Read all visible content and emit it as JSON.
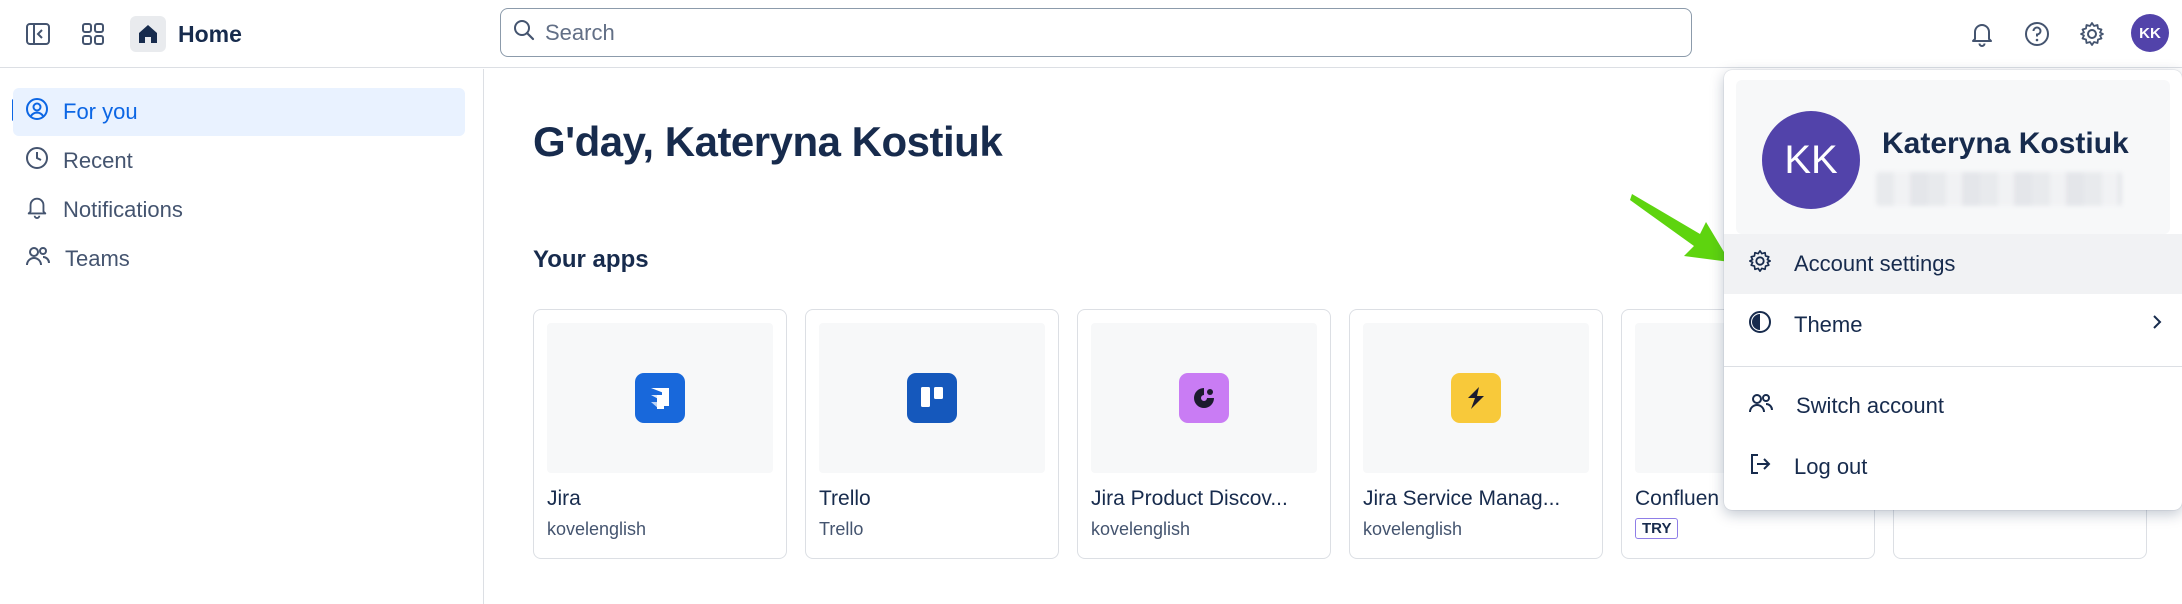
{
  "topbar": {
    "home_label": "Home",
    "search_placeholder": "Search",
    "avatar_initials": "KK"
  },
  "sidebar": {
    "items": [
      {
        "label": "For you",
        "icon": "user-circle-icon",
        "active": true
      },
      {
        "label": "Recent",
        "icon": "clock-icon",
        "active": false
      },
      {
        "label": "Notifications",
        "icon": "bell-icon",
        "active": false
      },
      {
        "label": "Teams",
        "icon": "people-icon",
        "active": false
      }
    ]
  },
  "main": {
    "greeting": "G'day, Kateryna Kostiuk",
    "apps_title": "Your apps",
    "apps": [
      {
        "name": "Jira",
        "sub": "kovelenglish",
        "icon": "jira-icon",
        "color": "#1868db"
      },
      {
        "name": "Trello",
        "sub": "Trello",
        "icon": "trello-icon",
        "color": "#1558bc"
      },
      {
        "name": "Jira Product Discov...",
        "sub": "kovelenglish",
        "icon": "product-discovery-icon",
        "color": "#c97cf4"
      },
      {
        "name": "Jira Service Manag...",
        "sub": "kovelenglish",
        "icon": "service-management-icon",
        "color": "#fca700"
      },
      {
        "name": "Confluen",
        "badge": "TRY",
        "icon": "confluence-icon"
      },
      {
        "name": ""
      }
    ]
  },
  "dropdown": {
    "profile": {
      "initials": "KK",
      "name": "Kateryna Kostiuk"
    },
    "items": [
      {
        "label": "Account settings",
        "icon": "gear-icon"
      },
      {
        "label": "Theme",
        "icon": "contrast-icon",
        "submenu": true
      },
      {
        "label": "Switch account",
        "icon": "switch-account-icon"
      },
      {
        "label": "Log out",
        "icon": "log-out-icon"
      }
    ]
  },
  "colors": {
    "accent": "#0c66e4",
    "avatar": "#5243aa",
    "annotation_arrow": "#5ed40f"
  }
}
